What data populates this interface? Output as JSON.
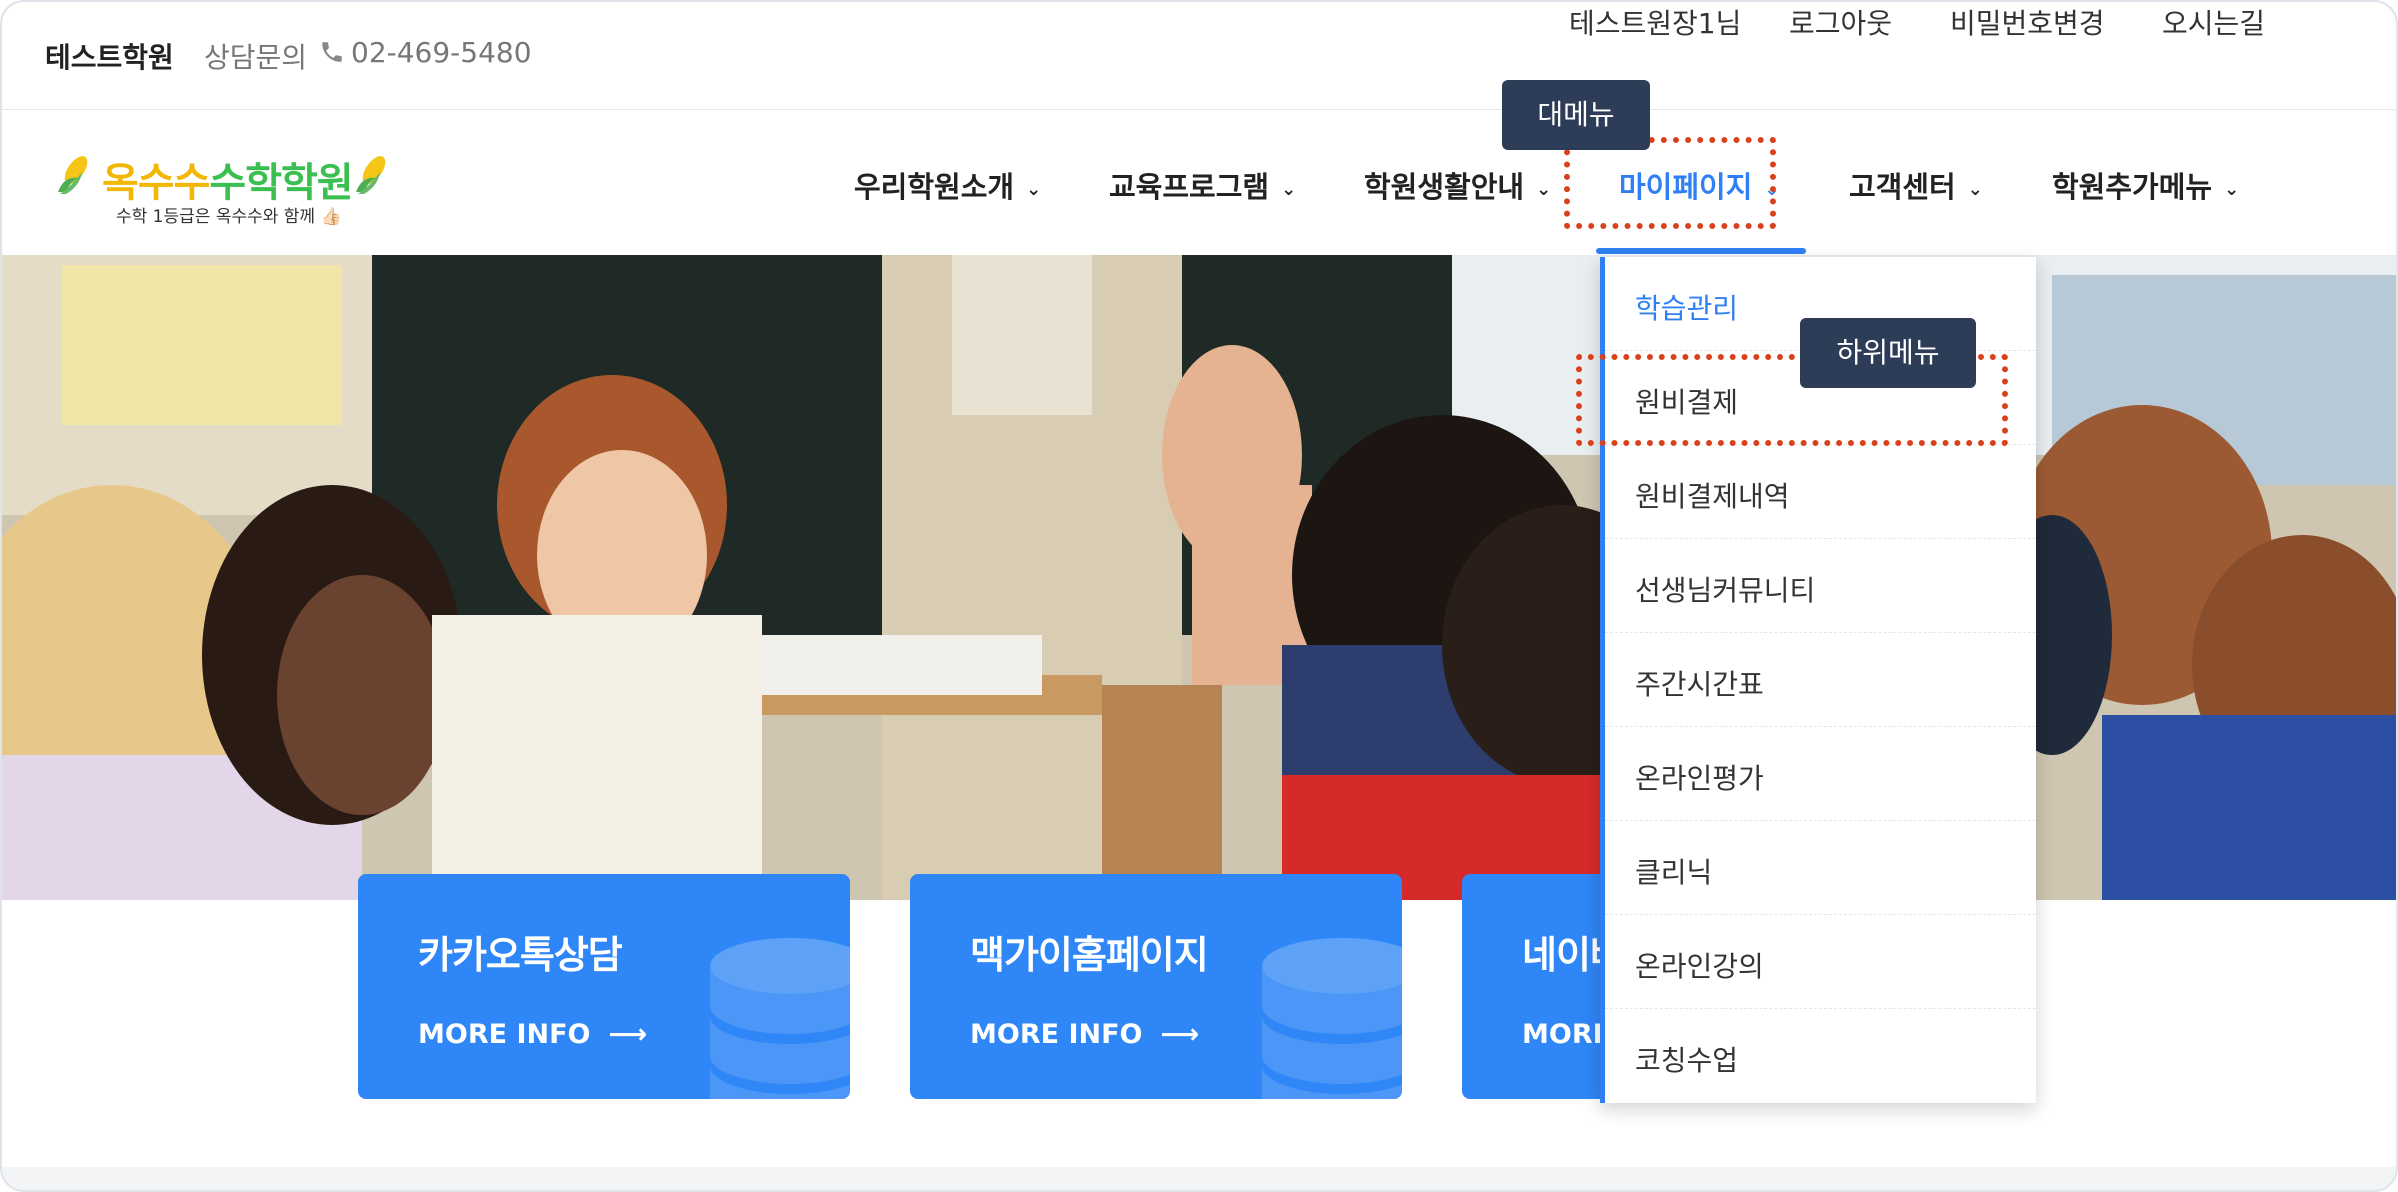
{
  "topbar": {
    "brand": "테스트학원",
    "consult_label": "상담문의",
    "phone": "02-469-5480",
    "links": [
      "테스트원장1님",
      "로그아웃",
      "비밀번호변경",
      "오시는길"
    ]
  },
  "logo": {
    "title_part1": "옥수수",
    "title_part2": "수학학원",
    "tagline": "수학 1등급은 옥수수와 함께 👍🏻"
  },
  "nav": {
    "items": [
      {
        "label": "우리학원소개"
      },
      {
        "label": "교육프로그램"
      },
      {
        "label": "학원생활안내"
      },
      {
        "label": "마이페이지",
        "active": true
      },
      {
        "label": "고객센터"
      },
      {
        "label": "학원추가메뉴"
      }
    ]
  },
  "dropdown": {
    "items": [
      "학습관리",
      "원비결제",
      "원비결제내역",
      "선생님커뮤니티",
      "주간시간표",
      "온라인평가",
      "클리닉",
      "온라인강의",
      "코칭수업"
    ]
  },
  "callouts": {
    "main_menu": "대메뉴",
    "sub_menu": "하위메뉴"
  },
  "cards": [
    {
      "title": "카카오톡상담",
      "more": "MORE INFO"
    },
    {
      "title": "맥가이홈페이지",
      "more": "MORE INFO"
    },
    {
      "title": "네이버",
      "more": "MORE INFO"
    }
  ],
  "colors": {
    "accent": "#2f7ff5",
    "card_blue": "#2f86f6",
    "callout_bg": "#2e3d57",
    "highlight_dotted": "#d8411c",
    "logo_yellow": "#f2b705",
    "logo_green": "#3bbf50"
  }
}
